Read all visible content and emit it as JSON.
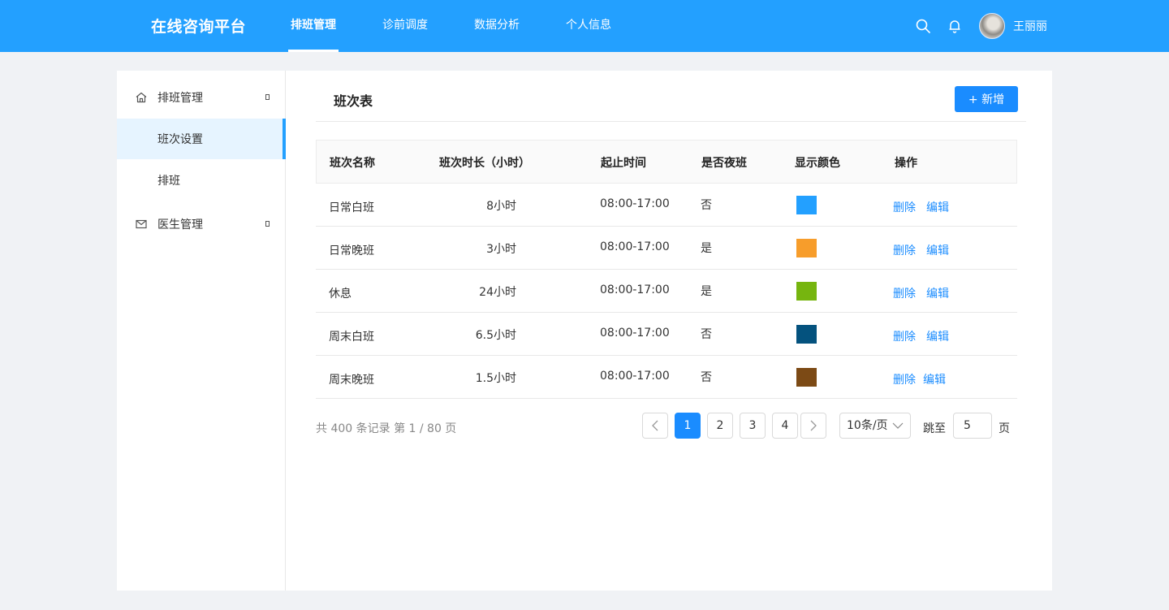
{
  "header": {
    "brand": "在线咨询平台",
    "tabs": [
      {
        "label": "排班管理"
      },
      {
        "label": "诊前调度"
      },
      {
        "label": "数据分析"
      },
      {
        "label": "个人信息"
      }
    ],
    "username": "王丽丽",
    "bg_color": "#23a0ff"
  },
  "sidebar": {
    "groups": [
      {
        "label": "排班管理",
        "icon": "home-icon",
        "children": [
          {
            "label": "班次设置"
          },
          {
            "label": "排班"
          }
        ]
      },
      {
        "label": "医生管理",
        "icon": "mail-icon"
      }
    ]
  },
  "main": {
    "title": "班次表",
    "add_button": "+  新增",
    "table": {
      "columns": [
        "班次名称",
        "班次时长（小时）",
        "起止时间",
        "是否夜班",
        "显示颜色",
        "操作"
      ],
      "rows": [
        {
          "name": "日常白班",
          "duration": "8小时",
          "time": "08:00-17:00",
          "night": "否",
          "color": "#23a0ff"
        },
        {
          "name": "日常晚班",
          "duration": "3小时",
          "time": "08:00-17:00",
          "night": "是",
          "color": "#f79d2b"
        },
        {
          "name": "休息",
          "duration": "24小时",
          "time": "08:00-17:00",
          "night": "是",
          "color": "#76b50f"
        },
        {
          "name": "周末白班",
          "duration": "6.5小时",
          "time": "08:00-17:00",
          "night": "否",
          "color": "#04527e"
        },
        {
          "name": "周末晚班",
          "duration": "1.5小时",
          "time": "08:00-17:00",
          "night": "否",
          "color": "#7c4a15"
        }
      ],
      "actions": {
        "delete": "删除",
        "edit": "编辑"
      }
    },
    "pagination": {
      "summary": "共 400 条记录 第 1 / 80 页",
      "pages": [
        "1",
        "2",
        "3",
        "4"
      ],
      "current_page": "1",
      "page_size": "10条/页",
      "jump_label": "跳至",
      "jump_value": "5",
      "page_unit": "页"
    }
  }
}
